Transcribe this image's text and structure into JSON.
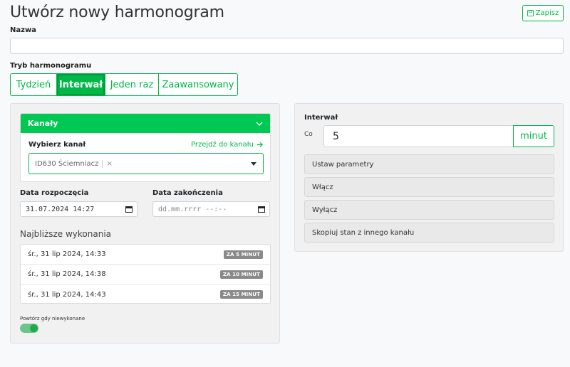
{
  "page": {
    "title": "Utwórz nowy harmonogram"
  },
  "toolbar": {
    "save_label": "Zapisz"
  },
  "form": {
    "name_label": "Nazwa",
    "name_value": "",
    "mode_label": "Tryb harmonogramu",
    "modes": [
      {
        "label": "Tydzień",
        "active": false
      },
      {
        "label": "Interwał",
        "active": true
      },
      {
        "label": "Jeden raz",
        "active": false
      },
      {
        "label": "Zaawansowany",
        "active": false
      }
    ]
  },
  "channels": {
    "header": "Kanały",
    "select_label": "Wybierz kanał",
    "goto_link": "Przejdź do kanału",
    "selected_channel": "ID630 Ściemniacz",
    "remove_glyph": "×"
  },
  "dates": {
    "start_label": "Data rozpoczęcia",
    "start_value": "31.07.2024 14:27",
    "end_label": "Data zakończenia",
    "end_value": "dd.mm.rrrr --:--"
  },
  "upcoming": {
    "title": "Najbliższe wykonania",
    "items": [
      {
        "date": "śr., 31 lip 2024, 14:33",
        "badge": "ZA 5 MINUT"
      },
      {
        "date": "śr., 31 lip 2024, 14:38",
        "badge": "ZA 10 MINUT"
      },
      {
        "date": "śr., 31 lip 2024, 14:43",
        "badge": "ZA 15 MINUT"
      }
    ]
  },
  "repeat": {
    "label": "Powtórz gdy niewykonane",
    "enabled": true
  },
  "interval": {
    "label": "Interwał",
    "prefix": "Co",
    "value": "5",
    "unit": "minut"
  },
  "actions": [
    {
      "label": "Ustaw parametry"
    },
    {
      "label": "Włącz"
    },
    {
      "label": "Wyłącz"
    },
    {
      "label": "Skopiuj stan z innego kanału"
    }
  ],
  "colors": {
    "accent": "#00b848",
    "header_green": "#00c853",
    "badge_gray": "#8a8a8a"
  }
}
